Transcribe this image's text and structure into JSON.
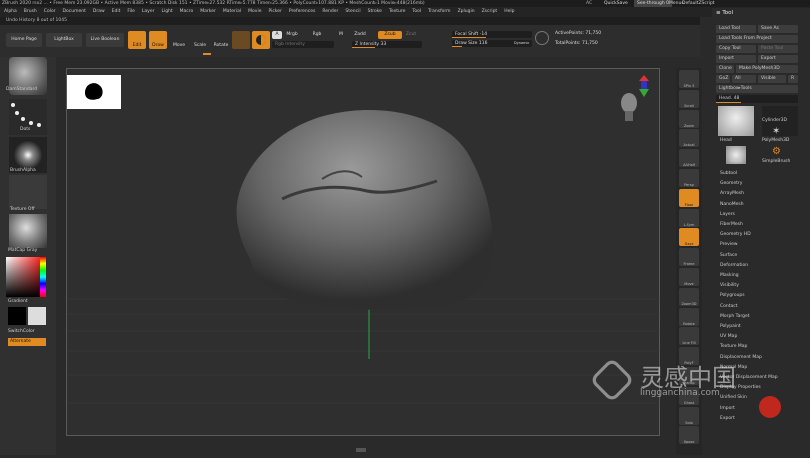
{
  "titlebar": {
    "text": "ZBrush 2020   rsx2 ...   • Free Mem 23.092GB • Active Mem 8385 • Scratch Disk 151 • ZTime▹27.532 RTime▹5.778 Timer▹25.366 • PolyCount▹107.881 KP • MeshCount▹1 Movie▹448(216mb)",
    "ac": "AC",
    "quicksave": "QuickSave",
    "seethrough": "See-through 0",
    "menus": "Menus",
    "defaultscript": "DefaultZScript"
  },
  "menubar": {
    "items": [
      "Alpha",
      "Brush",
      "Color",
      "Document",
      "Draw",
      "Edit",
      "File",
      "Layer",
      "Light",
      "Macro",
      "Marker",
      "Material",
      "Movie",
      "Picker",
      "Preferences",
      "Render",
      "Stencil",
      "Stroke",
      "Texture",
      "Tool",
      "Transform",
      "Zplugin",
      "Zscript",
      "Help"
    ]
  },
  "undo": {
    "text": "Undo History  8 out of 1045"
  },
  "toolbar": {
    "home": "Home Page",
    "lightbox": "LightBox",
    "liveboolean": "Live Boolean",
    "edit": "Edit",
    "draw": "Draw",
    "move": "Move",
    "scale": "Scale",
    "rotate": "Rotate",
    "a": "A",
    "mrgb": "Mrgb",
    "rgb": "Rgb",
    "m": "M",
    "zadd": "Zadd",
    "zsub": "Zsub",
    "zcut": "Zcut",
    "rgb_intensity": "Rgb Intensity",
    "z_intensity": "Z Intensity 33",
    "focal_shift": "Focal Shift -14",
    "draw_size": "Draw Size 116",
    "dynamic": "Dynamic",
    "active_points": "ActivePoints: 71,750",
    "total_points": "TotalPoints: 71,750"
  },
  "leftshelf": {
    "brush": "DamStandard",
    "stroke": "Dots",
    "alpha": "BrushAlpha",
    "texture": "Texture Off",
    "material": "MatCap Gray",
    "gradient": "Gradient",
    "switchcolor": "SwitchColor",
    "alternate": "Alternate"
  },
  "rightshelf": {
    "items": [
      "SPix 3",
      "Scroll",
      "Zoom",
      "Actual",
      "AAHalf",
      "Persp",
      "Floor",
      "L.Sym",
      "Gxyz",
      "Frame",
      "Move",
      "Zoom3D",
      "Rotate",
      "Line Fill",
      "PolyF",
      "Transp",
      "Ghost",
      "Solo",
      "Xpose"
    ]
  },
  "toolpanel": {
    "title": "Tool",
    "load_tool": "Load Tool",
    "save_as": "Save As",
    "load_project": "Load Tools From Project",
    "copy_tool": "Copy Tool",
    "paste_tool": "Paste Tool",
    "import": "Import",
    "export": "Export",
    "clone": "Clone",
    "make_polymesh": "Make PolyMesh3D",
    "goz": "GoZ",
    "all": "All",
    "visible": "Visible",
    "r": "R",
    "lightbox_tools": "Lightbox▸Tools",
    "head": "Head. 48",
    "thumbs": [
      "Head",
      "Cylinder3D",
      "PolyMesh3D",
      "Head",
      "SimpleBrush"
    ],
    "subpalettes": [
      "Subtool",
      "Geometry",
      "ArrayMesh",
      "NanoMesh",
      "Layers",
      "FiberMesh",
      "Geometry HD",
      "Preview",
      "Surface",
      "Deformation",
      "Masking",
      "Visibility",
      "Polygroups",
      "Contact",
      "Morph Target",
      "Polypaint",
      "UV Map",
      "Texture Map",
      "Displacement Map",
      "Normal Map",
      "Vector Displacement Map",
      "Display Properties",
      "Unified Skin",
      "Import",
      "Export"
    ]
  },
  "watermark": {
    "cn": "灵感中国",
    "url": "lingganchina.com"
  },
  "colors": {
    "accent": "#e08a22",
    "bg": "#2a2a2a"
  }
}
